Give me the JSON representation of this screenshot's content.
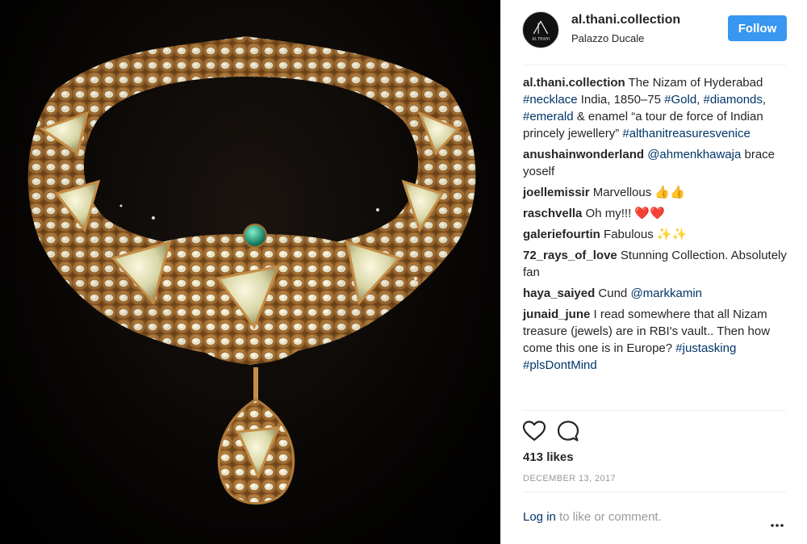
{
  "post": {
    "username": "al.thani.collection",
    "location": "Palazzo Ducale",
    "follow_label": "Follow",
    "avatar_text": "AL THANI",
    "likes": "413 likes",
    "date": "DECEMBER 13, 2017",
    "login_link": "Log in",
    "login_rest": " to like or comment."
  },
  "caption": {
    "user": "al.thani.collection",
    "t1": " The Nizam of Hyderabad ",
    "tag1": "#necklace",
    "t2": " India, 1850–75 ",
    "tag2": "#Gold",
    "t3": ", ",
    "tag3": "#diamonds",
    "t4": ", ",
    "tag4": "#emerald",
    "t5": " & enamel “a tour de force of Indian princely jewellery” ",
    "tag5": "#althanitreasuresvenice"
  },
  "comments": [
    {
      "user": "anushainwonderland",
      "mention": "@ahmenkhawaja",
      "text": " brace yoself"
    },
    {
      "user": "joellemissir",
      "text": " Marvellous 👍👍"
    },
    {
      "user": "raschvella",
      "text": " Oh my!!! ❤️❤️"
    },
    {
      "user": "galeriefourtin",
      "text": " Fabulous ✨✨"
    },
    {
      "user": "72_rays_of_love",
      "text": " Stunning Collection. Absolutely fan"
    },
    {
      "user": "haya_saiyed",
      "text": " Cund ",
      "mention": "@markkamin"
    },
    {
      "user": "junaid_june",
      "text": " I read somewhere that all Nizam treasure (jewels) are in RBI's vault.. Then how come this one is in Europe? ",
      "tag1": "#justasking",
      "tag2": "#plsDontMind"
    }
  ],
  "icons": {
    "like": "heart-icon",
    "comment": "comment-bubble-icon",
    "more": "more-options-icon"
  },
  "colors": {
    "follow_button": "#3897f0",
    "link": "#003569",
    "muted": "#999999"
  }
}
